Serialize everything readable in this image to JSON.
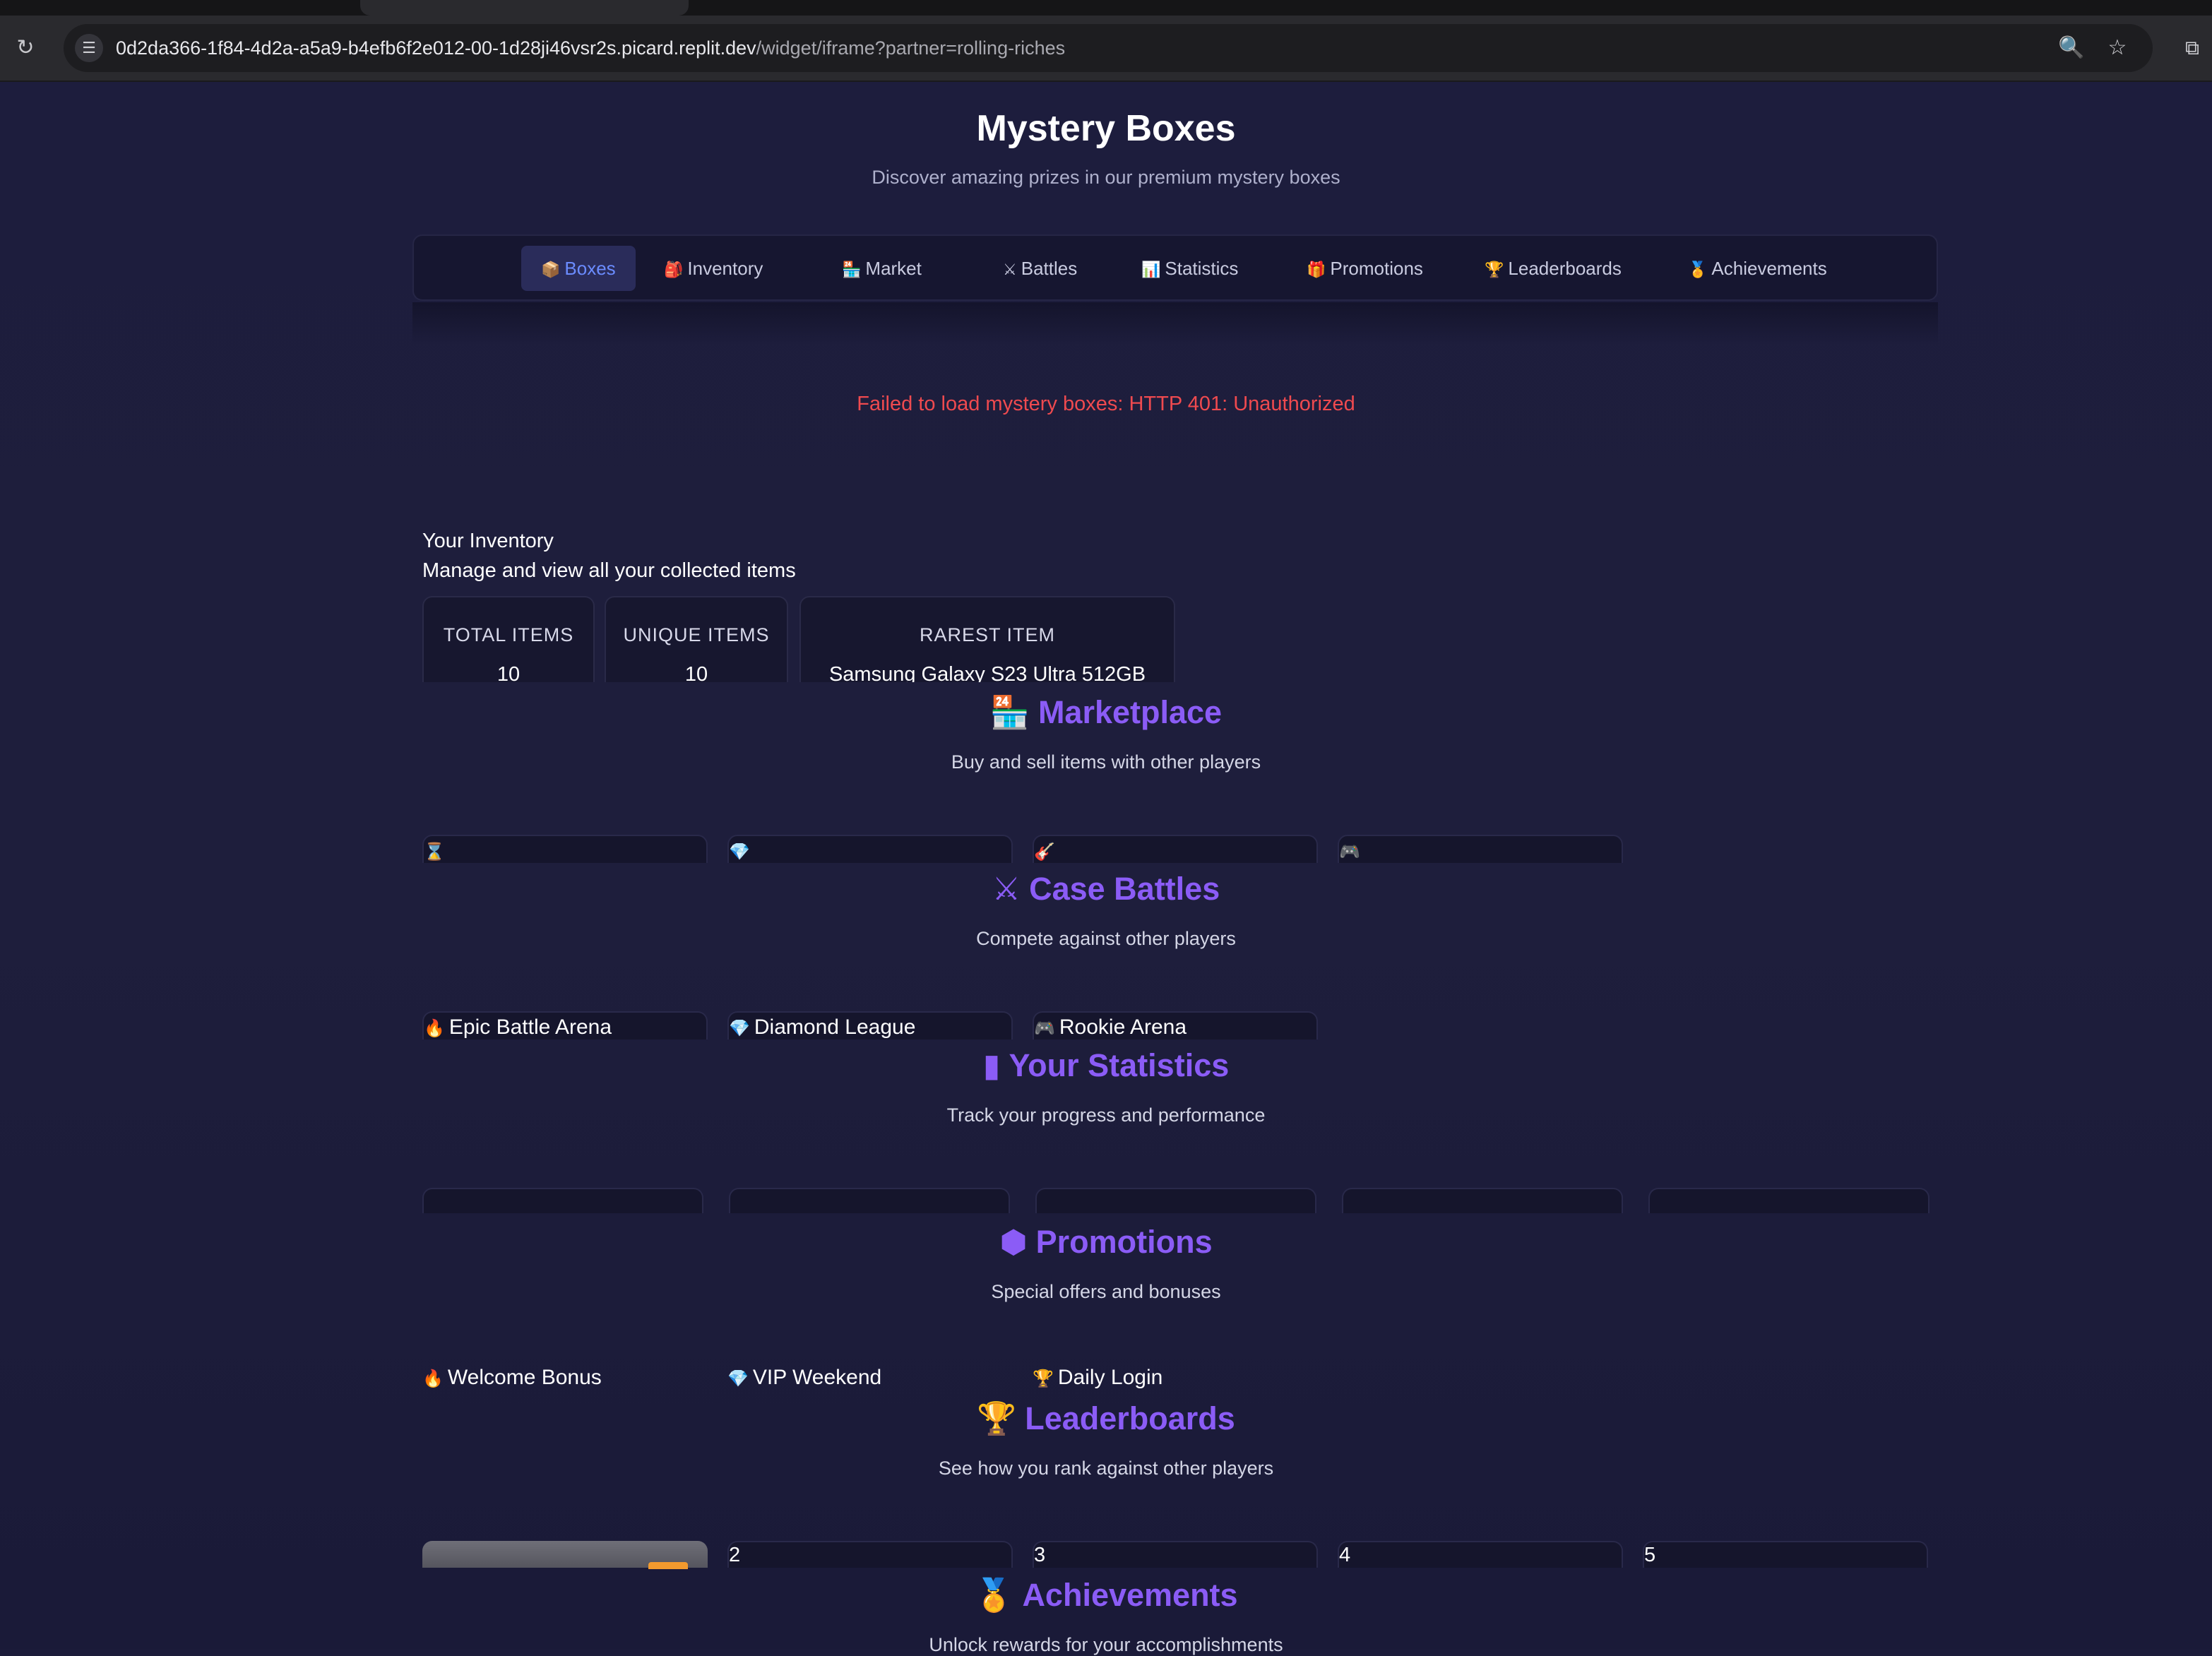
{
  "browser": {
    "url_host": "0d2da366-1f84-4d2a-a5a9-b4efb6f2e012-00-1d28ji46vsr2s.picard.replit.dev",
    "url_path": "/widget/iframe?partner=rolling-riches",
    "icons": {
      "reload": "↻",
      "site_info": "☰",
      "zoom": "🔍",
      "bookmark": "☆",
      "extensions": "⧉"
    }
  },
  "header": {
    "title": "Mystery Boxes",
    "subtitle": "Discover amazing prizes in our premium mystery boxes"
  },
  "nav": {
    "tabs": [
      {
        "icon": "📦",
        "label": "Boxes",
        "active": true
      },
      {
        "icon": "🎒",
        "label": "Inventory"
      },
      {
        "icon": "🏪",
        "label": "Market"
      },
      {
        "icon": "⚔",
        "label": "Battles"
      },
      {
        "icon": "📊",
        "label": "Statistics"
      },
      {
        "icon": "🎁",
        "label": "Promotions"
      },
      {
        "icon": "🏆",
        "label": "Leaderboards"
      },
      {
        "icon": "🏅",
        "label": "Achievements"
      }
    ]
  },
  "error_message": "Failed to load mystery boxes: HTTP 401: Unauthorized",
  "inventory": {
    "title": "Your Inventory",
    "subtitle": "Manage and view all your collected items",
    "stats": [
      {
        "label": "TOTAL ITEMS",
        "value": "10"
      },
      {
        "label": "UNIQUE ITEMS",
        "value": "10"
      },
      {
        "label": "RAREST ITEM",
        "value": "Samsung Galaxy S23 Ultra 512GB"
      }
    ]
  },
  "marketplace": {
    "icon": "🏪",
    "title": "Marketplace",
    "subtitle": "Buy and sell items with other players",
    "cards": [
      {
        "icon": "⌛"
      },
      {
        "icon": "💎"
      },
      {
        "icon": "🎸"
      },
      {
        "icon": "🎮"
      }
    ]
  },
  "battles": {
    "icon": "⚔",
    "title": "Case Battles",
    "subtitle": "Compete against other players",
    "cards": [
      {
        "icon": "🔥",
        "label": "Epic Battle Arena"
      },
      {
        "icon": "💎",
        "label": "Diamond League"
      },
      {
        "icon": "🎮",
        "label": "Rookie Arena"
      }
    ]
  },
  "statistics": {
    "icon": "▮",
    "title": "Your Statistics",
    "subtitle": "Track your progress and performance"
  },
  "promotions": {
    "icon": "⬢",
    "title": "Promotions",
    "subtitle": "Special offers and bonuses",
    "items": [
      {
        "icon": "🔥",
        "label": "Welcome Bonus"
      },
      {
        "icon": "💎",
        "label": "VIP Weekend"
      },
      {
        "icon": "🏆",
        "label": "Daily Login"
      }
    ]
  },
  "leaderboards": {
    "icon": "🏆",
    "title": "Leaderboards",
    "subtitle": "See how you rank against other players",
    "ranks": [
      "2",
      "3",
      "4",
      "5"
    ]
  },
  "achievements": {
    "icon": "🏅",
    "title": "Achievements",
    "subtitle": "Unlock rewards for your accomplishments"
  }
}
